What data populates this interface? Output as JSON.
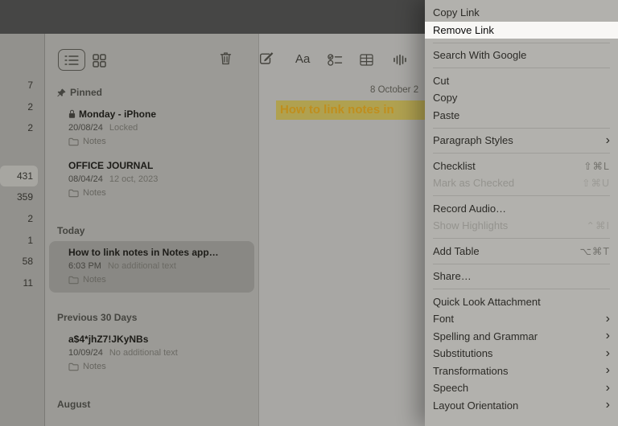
{
  "colors": {
    "spotlight_bg": "#f8f7f5",
    "note_title_text": "#bf8e1e",
    "note_title_highlight": "#b0a150"
  },
  "sidebar": {
    "counts": [
      {
        "count": "7"
      },
      {
        "count": "2"
      },
      {
        "count": "2"
      },
      {
        "count": "431",
        "selected": true
      },
      {
        "count": "359"
      },
      {
        "count": "2"
      },
      {
        "count": "1"
      },
      {
        "count": "58"
      },
      {
        "count": "11"
      }
    ]
  },
  "toolbar": {
    "format_label": "Aa",
    "icons": [
      "list-view-icon",
      "gallery-view-icon",
      "trash-icon",
      "compose-icon",
      "format-text",
      "checklist-icon",
      "table-icon",
      "audio-icon"
    ]
  },
  "notes_list": {
    "sections": [
      {
        "header": "Pinned",
        "icon": "pin-icon",
        "notes": [
          {
            "title": "Monday - iPhone",
            "locked": true,
            "date": "20/08/24",
            "preview": "Locked",
            "folder": "Notes"
          },
          {
            "title": "OFFICE JOURNAL",
            "date": "08/04/24",
            "preview": "12 oct, 2023",
            "folder": "Notes"
          }
        ]
      },
      {
        "header": "Today",
        "notes": [
          {
            "title": "How to link notes in Notes app…",
            "selected": true,
            "date": "6:03 PM",
            "preview": "No additional text",
            "folder": "Notes"
          }
        ]
      },
      {
        "header": "Previous 30 Days",
        "notes": [
          {
            "title": "a$4*jhZ7!JKyNBs",
            "date": "10/09/24",
            "preview": "No additional text",
            "folder": "Notes"
          }
        ]
      },
      {
        "header": "August",
        "notes": []
      }
    ]
  },
  "note_editor": {
    "date_line": "8 October 2",
    "title": "How to link notes in "
  },
  "context_menu": {
    "chevron": "›",
    "groups": [
      {
        "items": [
          {
            "label": "Copy Link"
          },
          {
            "label": "Remove Link",
            "highlighted": true
          }
        ]
      },
      {
        "items": [
          {
            "label": "Search With Google"
          }
        ]
      },
      {
        "items": [
          {
            "label": "Cut"
          },
          {
            "label": "Copy"
          },
          {
            "label": "Paste"
          }
        ]
      },
      {
        "items": [
          {
            "label": "Paragraph Styles",
            "submenu": true
          }
        ]
      },
      {
        "items": [
          {
            "label": "Checklist",
            "shortcut": "⇧⌘L"
          },
          {
            "label": "Mark as Checked",
            "shortcut": "⇧⌘U",
            "disabled": true
          }
        ]
      },
      {
        "items": [
          {
            "label": "Record Audio…"
          },
          {
            "label": "Show Highlights",
            "shortcut": "⌃⌘I",
            "disabled": true
          }
        ]
      },
      {
        "items": [
          {
            "label": "Add Table",
            "shortcut": "⌥⌘T"
          }
        ]
      },
      {
        "items": [
          {
            "label": "Share…"
          }
        ]
      },
      {
        "items": [
          {
            "label": "Quick Look Attachment"
          },
          {
            "label": "Font",
            "submenu": true
          },
          {
            "label": "Spelling and Grammar",
            "submenu": true
          },
          {
            "label": "Substitutions",
            "submenu": true
          },
          {
            "label": "Transformations",
            "submenu": true
          },
          {
            "label": "Speech",
            "submenu": true
          },
          {
            "label": "Layout Orientation",
            "submenu": true
          }
        ]
      }
    ]
  }
}
